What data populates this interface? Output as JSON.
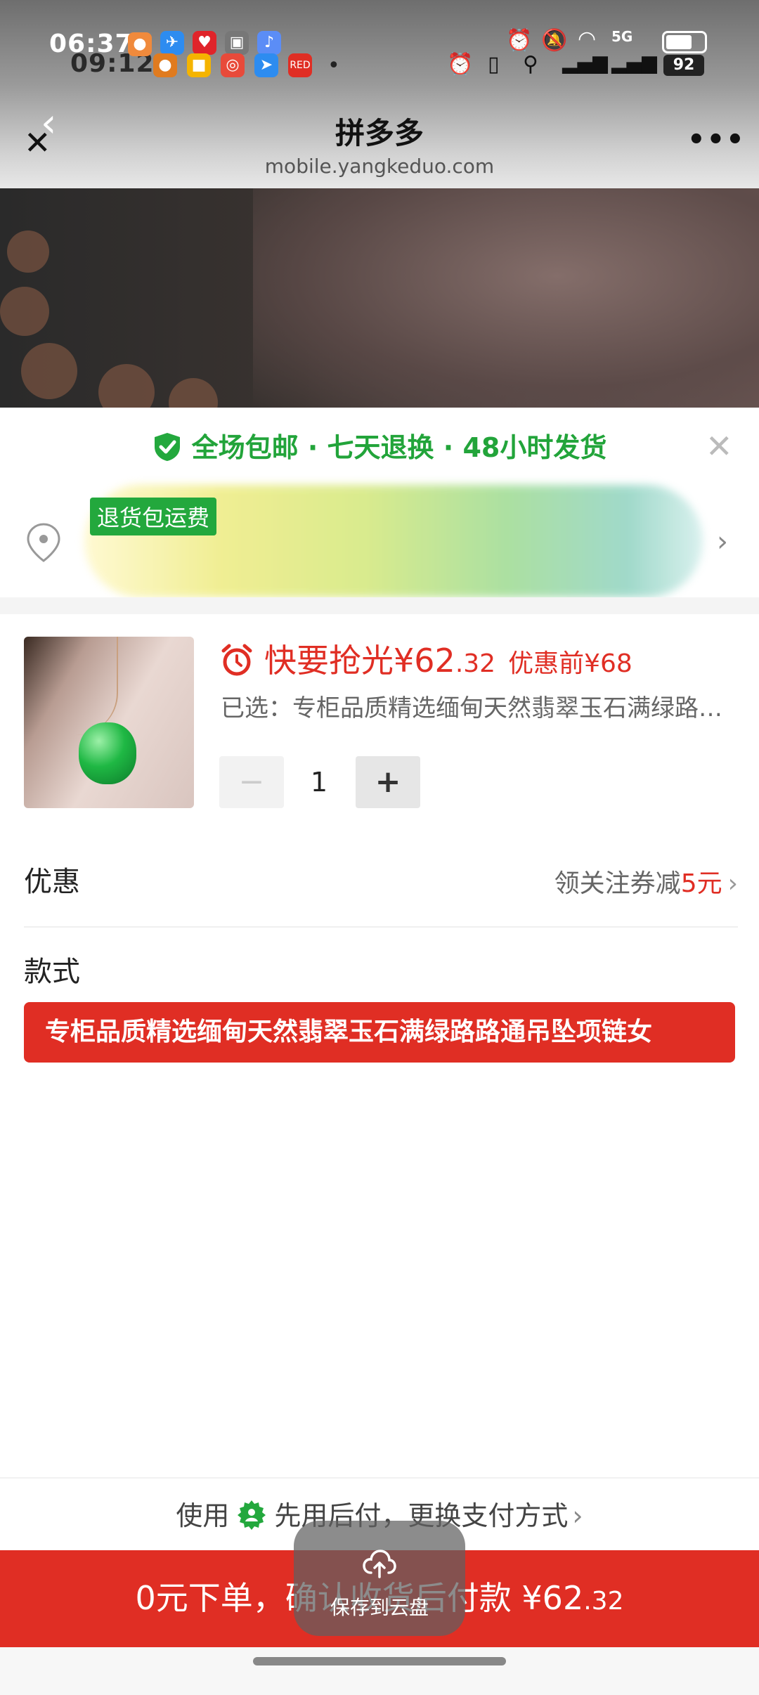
{
  "status_bar": {
    "time_primary": "06:37",
    "time_secondary": "09:12",
    "battery": "92",
    "network": "5G"
  },
  "browser": {
    "title": "拼多多",
    "url": "mobile.yangkeduo.com",
    "more": "•••"
  },
  "banner": {
    "text": "全场包邮 · 七天退换 · 48小时发货",
    "tag": "退货包运费"
  },
  "product": {
    "status": "快要抢光",
    "currency": "¥",
    "price_int": "62",
    "price_dec": ".32",
    "original_price": "优惠前¥68",
    "selected": "已选：专柜品质精选缅甸天然翡翠玉石满绿路路通吊坠项链",
    "quantity": "1"
  },
  "coupon": {
    "label": "优惠",
    "text": "领关注券减",
    "amount": "5元"
  },
  "style": {
    "label": "款式",
    "option": "专柜品质精选缅甸天然翡翠玉石满绿路路通吊坠项链女"
  },
  "payment": {
    "prefix": "使用",
    "text": "先用后付，更换支付方式"
  },
  "buy": {
    "text": "0元下单，确认收货后付款 ¥62",
    "dec": ".32"
  },
  "cloud_save": {
    "label": "保存到云盘"
  },
  "colors": {
    "brand_red": "#e02e24",
    "brand_green": "#23a83d"
  },
  "icons": [
    "close-icon",
    "back-icon",
    "more-icon",
    "shield-check-icon",
    "location-icon",
    "chevron-right-icon",
    "alarm-clock-icon",
    "minus-icon",
    "plus-icon",
    "pay-later-icon",
    "cloud-upload-icon"
  ]
}
